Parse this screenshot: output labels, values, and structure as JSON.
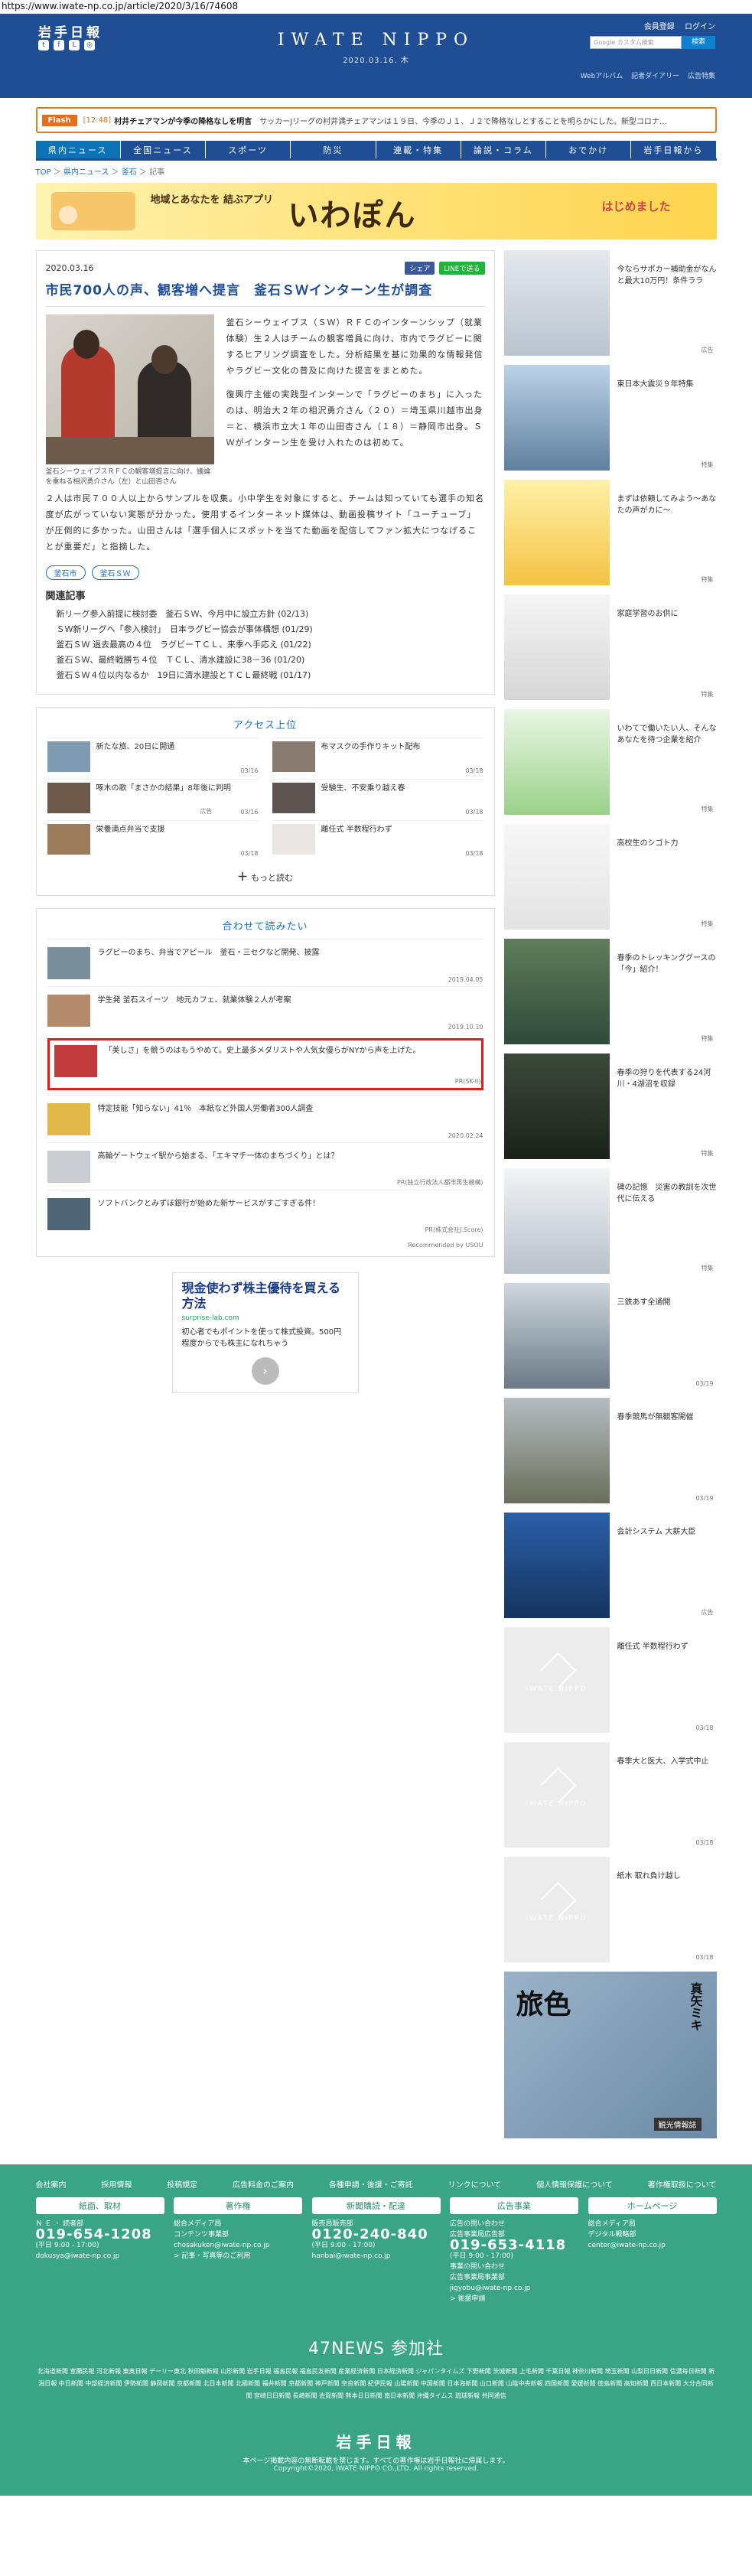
{
  "browser": {
    "url": "https://www.iwate-np.co.jp/article/2020/3/16/74608"
  },
  "header": {
    "logo": "岩手日報",
    "center_logo": "IWATE NIPPO",
    "date": "2020.03.16. 木",
    "top_links": [
      "会員登録",
      "ログイン"
    ],
    "search_placeholder": "Google カスタム検索",
    "search_button": "検索",
    "sub_links": [
      "Webアルバム",
      "記者ダイアリー",
      "広告特集"
    ]
  },
  "flash": {
    "badge": "Flash",
    "time": "[12:48]",
    "title": "村井チェアマンが今季の降格なしを明言",
    "body": "サッカーJリーグの村井満チェアマンは１９日、今季のＪ１、Ｊ２で降格なしとすることを明らかにした。新型コロナ…"
  },
  "nav": [
    "県内ニュース",
    "全国ニュース",
    "スポーツ",
    "防災",
    "連載・特集",
    "論説・コラム",
    "おでかけ",
    "岩手日報から"
  ],
  "breadcrumb": [
    "TOP",
    "県内ニュース",
    "釜石",
    "記事"
  ],
  "banner": {
    "sub": "地域とあなたを\n結ぶアプリ",
    "main": "いわぽん",
    "right": "はじめました"
  },
  "article": {
    "date": "2020.03.16",
    "share_fb": "シェア",
    "share_line": "LINEで送る",
    "title": "市民700人の声、観客増へ提言　釜石ＳＷインターン生が調査",
    "caption": "釜石シーウェイブスＲＦＣの観客増提言に向け、議論を重ねる相沢勇介さん（左）と山田杏さん",
    "p1": "釜石シーウェイブス（ＳＷ）ＲＦＣのインターンシップ（就業体験）生２人はチームの観客増員に向け、市内でラグビーに関するヒアリング調査をした。分析結果を基に効果的な情報発信やラグビー文化の普及に向けた提言をまとめた。",
    "p2": "復興庁主催の実践型インターンで「ラグビーのまち」に入ったのは、明治大２年の相沢勇介さん（２０）＝埼玉県川越市出身＝と、横浜市立大１年の山田杏さん（１８）＝静岡市出身。ＳＷがインターン生を受け入れたのは初めて。",
    "p3": "２人は市民７００人以上からサンプルを収集。小中学生を対象にすると、チームは知っていても選手の知名度が広がっていない実態が分かった。使用するインターネット媒体は、動画投稿サイト「ユーチューブ」が圧倒的に多かった。山田さんは「選手個人にスポットを当てた動画を配信してファン拡大につなげることが重要だ」と指摘した。",
    "tags": [
      "釜石市",
      "釜石ＳＷ"
    ],
    "related_head": "関連記事",
    "related": [
      "新リーグ参入前提に検討委　釜石ＳＷ、今月中に設立方針 (02/13)",
      "ＳＷ新リーグへ「参入検討」　日本ラグビー協会が事体構想 (01/29)",
      "釜石ＳＷ 過去最高の４位　ラグビーＴＣＬ、来季へ手応え (01/22)",
      "釜石ＳＷ、最終戦勝ち４位　ＴＣＬ、清水建設に38－36 (01/20)",
      "釜石ＳＷ４位以内なるか　19日に清水建設とＴＣＬ最終戦 (01/17)"
    ]
  },
  "access": {
    "title": "アクセス上位",
    "items": [
      {
        "text": "新たな旅、20日に開通",
        "date": "03/16"
      },
      {
        "text": "布マスクの手作りキット配布",
        "date": "03/18"
      },
      {
        "text": "啄木の歌「まさかの結果」8年後に判明",
        "date": "03/16",
        "ad": "広告"
      },
      {
        "text": "受験生、不安乗り越え春",
        "date": "03/18"
      },
      {
        "text": "栄養満点弁当で支援",
        "date": "03/18"
      },
      {
        "text": "離任式 半数程行わず",
        "date": "03/18"
      }
    ],
    "more": "もっと読む"
  },
  "recommend": {
    "title": "合わせて読みたい",
    "items": [
      {
        "text": "ラグビーのまち、弁当でアピール　釜石・三セクなど開発、披露",
        "date": "2019.04.05"
      },
      {
        "text": "学生発 釜石スイーツ　地元カフェ、就業体験２人が考案",
        "date": "2019.10.10"
      },
      {
        "text": "「美しさ」を競うのはもうやめて。史上最多メダリストや人気女優らがNYから声を上げた。",
        "date": "PR(SK-II)"
      },
      {
        "text": "特定技能「知らない」41％　本紙など外国人労働者300人調査",
        "date": "2020.02.24"
      },
      {
        "text": "高輪ゲートウェイ駅から始まる、「エキマチ一体のまちづくり」とは？",
        "date": "PR(独立行政法人都市再生機構)"
      },
      {
        "text": "ソフトバンクとみずほ銀行が始めた新サービスがすごすぎる件！",
        "date": "PR(株式会社J.Score)"
      }
    ],
    "credit": "Recommended by USOU"
  },
  "ad": {
    "title": "現金使わず株主優待を買える方法",
    "url": "surprise-lab.com",
    "body": "初心者でもポイントを使って株式投資。500円程度からでも株主になれちゃう",
    "btn": "›"
  },
  "sidebar": [
    {
      "text": "今ならサポカー補助金がなんと最大10万円！条件ララ",
      "tag": "広告"
    },
    {
      "text": "東日本大震災９年特集",
      "tag": "特集"
    },
    {
      "text": "まずは依頼してみよう～あなたの声がカに～",
      "tag": "特集"
    },
    {
      "text": "家庭学習のお供に",
      "tag": "特集"
    },
    {
      "text": "いわてで働いたい人、そんなあなたを待つ企業を紹介",
      "tag": "特集"
    },
    {
      "text": "高校生のシゴト力",
      "tag": "特集"
    },
    {
      "text": "春季のトレッキンググースの「今」紹介！",
      "tag": "特集"
    },
    {
      "text": "春季の狩りを代表する24河川・4湖沼を収録",
      "tag": "特集"
    },
    {
      "text": "碑の記憶　災害の教訓を次世代に伝える",
      "tag": "特集"
    },
    {
      "text": "三鉄あす全通開",
      "tag": "03/19"
    },
    {
      "text": "春季競馬が無観客開催",
      "tag": "03/19"
    },
    {
      "text": "会計システム 大薪大臣",
      "tag": "広告"
    },
    {
      "text": "離任式 半数程行わず",
      "tag": "03/18"
    },
    {
      "text": "春季大と医大、入学式中止",
      "tag": "03/18"
    },
    {
      "text": "紙木 取れ負け越し",
      "tag": "03/18"
    }
  ],
  "sidebar_big": {
    "t1": "旅色",
    "t2": "真矢ミキ",
    "t3": "観光情報誌"
  },
  "footer": {
    "links": [
      "会社案内",
      "採用情報",
      "投稿規定",
      "広告料金のご案内",
      "各種申請・後援・ご寄託",
      "リンクについて",
      "個人情報保護について",
      "著作権取扱について"
    ],
    "cols": [
      {
        "head": "紙面、取材",
        "sub": "Ｎ Ｅ ・ 読者部",
        "tel": "019-654-1208",
        "hours": "(平日 9:00 - 17:00)",
        "mail": "dokusya@iwate-np.co.jp"
      },
      {
        "head": "著作権",
        "sub": "総合メディア局\nコンテンツ事業部",
        "tel": "",
        "hours": "",
        "mail": "chosakuken@iwate-np.co.jp\n> 記事・写真等のご利用"
      },
      {
        "head": "新聞購読・配達",
        "sub": "販売局販売部",
        "tel": "0120-240-840",
        "hours": "(平日 9:00 - 17:00)",
        "mail": "hanbai@iwate-np.co.jp"
      },
      {
        "head": "広告事業",
        "sub": "広告の問い合わせ\n広告事業局広告部",
        "tel": "019-653-4118",
        "hours": "(平日 9:00 - 17:00)",
        "mail": "事業の問い合わせ\n広告事業局事業部\njigyobu@iwate-np.co.jp\n> 後援申請"
      },
      {
        "head": "ホームページ",
        "sub": "総合メディア局\nデジタル戦略部",
        "tel": "",
        "hours": "",
        "mail": "center@iwate-np.co.jp"
      }
    ],
    "news_head": "47NEWS 参加社",
    "news_list": "北海道新聞 室蘭民報 河北新報 東奥日報 デーリー東北 秋田魁新報 山形新聞 岩手日報 福島民報 福島民友新聞 産業経済新聞 日本経済新聞 ジャパンタイムズ 下野新聞 茨城新聞 上毛新聞 千葉日報 神奈川新聞 埼玉新聞 山梨日日新聞 信濃毎日新聞 新潟日報 中日新聞 中部経済新聞 伊勢新聞 静岡新聞 京都新聞 北日本新聞 北國新聞 福井新聞 京都新聞 神戸新聞 奈良新聞 紀伊民報 山陽新聞 中国新聞 日本海新聞 山口新聞 山陰中央新報 四国新聞 愛媛新聞 徳島新聞 高知新聞 西日本新聞 大分合同新聞 宮崎日日新聞 長崎新聞 佐賀新聞 熊本日日新聞 南日本新聞 沖縄タイムス 琉球新報 共同通信",
    "logo": "岩手日報",
    "copy": "本ページ掲載内容の無断転載を禁じます。すべての著作権は岩手日報社に帰属します。",
    "copy2": "Copyright©2020, IWATE NIPPO CO.,LTD. All rights reserved."
  }
}
